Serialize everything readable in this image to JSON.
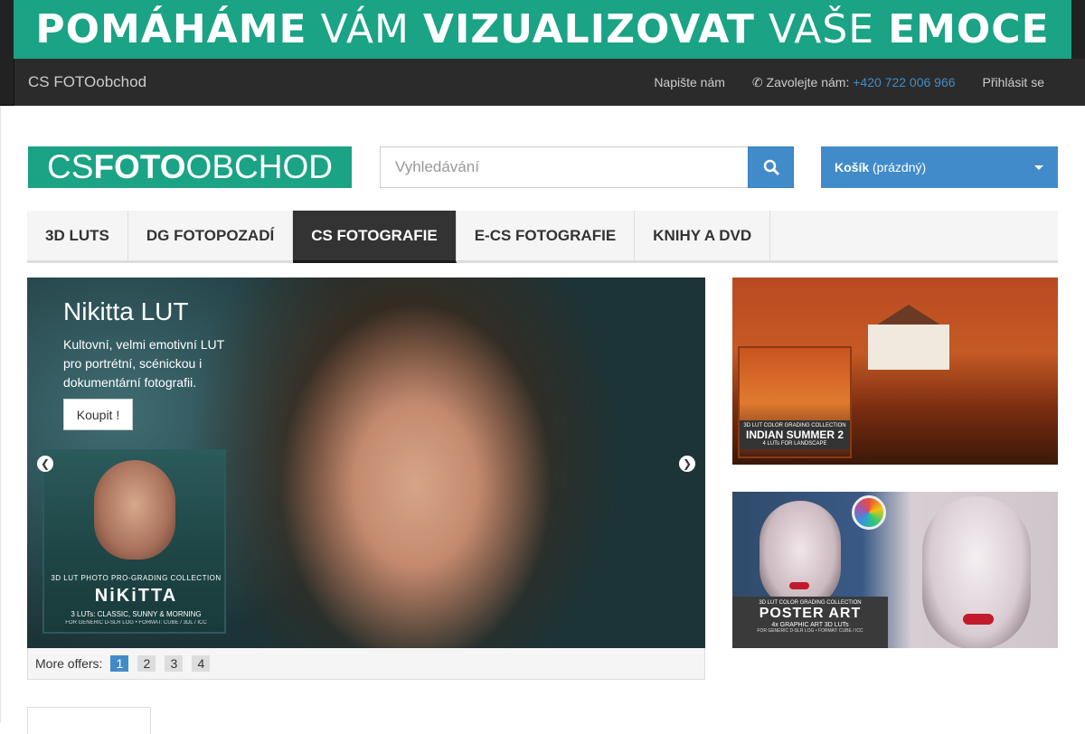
{
  "banner": {
    "w1": "POMÁHÁME",
    "w2": "VÁM",
    "w3": "VIZUALIZOVAT",
    "w4": "VAŠE",
    "w5": "EMOCE"
  },
  "navbar": {
    "brand": "CS FOTOobchod",
    "write_us": "Napište nám",
    "call_label": "Zavolejte nám:",
    "phone": "+420 722 006 966",
    "login": "Přihlásit se"
  },
  "logo": {
    "part1": "CS ",
    "part2": "FOTO",
    "part3": "OBCHOD"
  },
  "search": {
    "placeholder": "Vyhledávání"
  },
  "cart": {
    "label": "Košík",
    "status": "(prázdný)"
  },
  "menu": {
    "items": [
      {
        "label": "3D LUTS"
      },
      {
        "label": "DG FOTOPOZADÍ"
      },
      {
        "label": "CS FOTOGRAFIE"
      },
      {
        "label": "E-CS FOTOGRAFIE"
      },
      {
        "label": "KNIHY A DVD"
      }
    ],
    "active_index": 2
  },
  "carousel": {
    "title": "Nikitta LUT",
    "description": "Kultovní, velmi emotivní LUT pro portrétní, scénickou i dokumentární fotografii.",
    "buy_label": "Koupit !",
    "product": {
      "line1": "3D LUT PHOTO PRO-GRADING COLLECTION",
      "line2": "NiKiTTA",
      "line3": "3 LUTs: CLASSIC, SUNNY & MORNING",
      "line4": "FOR GENERIC D-SLR LOG • FORMAT: CUBE / 3DL / ICC"
    },
    "prev_icon": "chevron-left-icon",
    "next_icon": "chevron-right-icon"
  },
  "pager": {
    "label": "More offers:",
    "pages": [
      "1",
      "2",
      "3",
      "4"
    ],
    "active": "1"
  },
  "side1": {
    "line1": "3D LUT COLOR GRADING COLLECTION",
    "line2": "INDIAN SUMMER 2",
    "line3": "4 LUTs FOR LANDSCAPE"
  },
  "side2": {
    "line1": "3D LUT COLOR GRADING COLLECTION",
    "line2": "POSTER ART",
    "line3": "4x GRAPHIC ART 3D LUTs",
    "line4": "FOR GENERIC D-SLR LOG • FORMAT: CUBE / ICC"
  },
  "colors": {
    "brand_green": "#1aa384",
    "primary_blue": "#428bca",
    "navbar_dark": "#222222"
  }
}
